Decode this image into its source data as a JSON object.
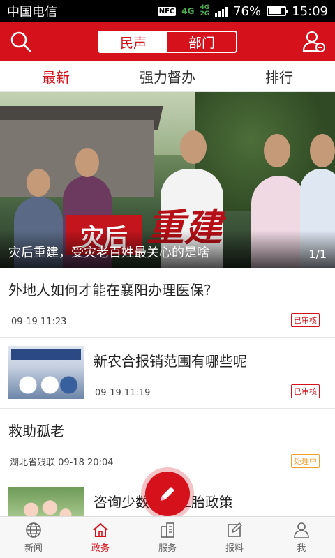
{
  "status_bar": {
    "carrier": "中国电信",
    "nfc": "NFC",
    "network_1": "4G",
    "network_2": "4G",
    "network_3": "2G",
    "battery": "76%",
    "time": "15:09"
  },
  "header": {
    "segments": [
      {
        "label": "民声",
        "active": true
      },
      {
        "label": "部门",
        "active": false
      }
    ],
    "left_icon": "search-icon",
    "right_icon": "user-group-icon"
  },
  "tabs": [
    {
      "label": "最新",
      "active": true
    },
    {
      "label": "强力督办",
      "active": false
    },
    {
      "label": "排行",
      "active": false
    }
  ],
  "banner": {
    "promo_text_1": "灾后",
    "promo_text_2": "重建",
    "caption": "灾后重建，受灾老百姓最关心的是啥",
    "pager": "1/1"
  },
  "list": [
    {
      "title": "外地人如何才能在襄阳办理医保?",
      "meta": "09-19 11:23",
      "badge": "已审核",
      "badge_color": "#d5111b"
    },
    {
      "title": "新农合报销范围有哪些呢",
      "meta": "09-19 11:19",
      "badge": "已审核",
      "badge_color": "#d5111b"
    },
    {
      "title": "救助孤老",
      "meta": "湖北省残联 09-18 20:04",
      "badge": "处理中",
      "badge_color": "#f0a12b"
    },
    {
      "title": "咨询少数民族二胎政策",
      "meta": "",
      "badge": ""
    }
  ],
  "fab": {
    "icon": "edit-icon"
  },
  "bottom_nav": [
    {
      "label": "新闻",
      "icon": "globe-icon",
      "active": false
    },
    {
      "label": "政务",
      "icon": "home-icon",
      "active": true
    },
    {
      "label": "服务",
      "icon": "building-icon",
      "active": false
    },
    {
      "label": "报料",
      "icon": "edit-box-icon",
      "active": false
    },
    {
      "label": "我",
      "icon": "person-icon",
      "active": false
    }
  ],
  "colors": {
    "primary": "#d5111b",
    "pending": "#f0a12b"
  }
}
